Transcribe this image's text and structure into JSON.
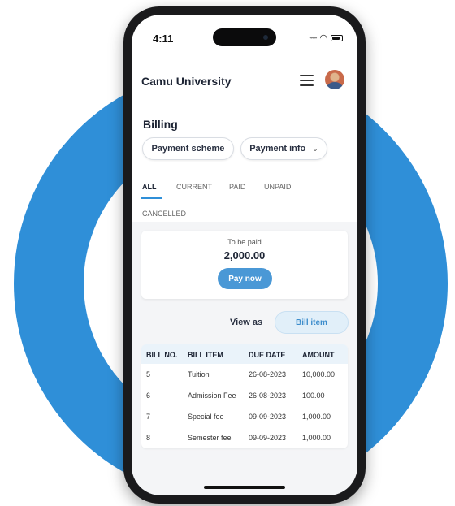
{
  "status_bar": {
    "time": "4:11"
  },
  "header": {
    "title": "Camu University"
  },
  "billing": {
    "title": "Billing",
    "buttons": {
      "payment_scheme": "Payment scheme",
      "payment_info": "Payment info"
    },
    "tabs": [
      {
        "label": "ALL",
        "active": true
      },
      {
        "label": "CURRENT",
        "active": false
      },
      {
        "label": "PAID",
        "active": false
      },
      {
        "label": "UNPAID",
        "active": false
      },
      {
        "label": "CANCELLED",
        "active": false
      }
    ]
  },
  "to_be_paid": {
    "label": "To be paid",
    "amount": "2,000.00",
    "pay_button": "Pay now"
  },
  "view_as": {
    "label": "View as",
    "selected": "Bill item"
  },
  "table": {
    "headers": [
      "BILL NO.",
      "BILL ITEM",
      "DUE DATE",
      "AMOUNT"
    ],
    "rows": [
      [
        "5",
        "Tuition",
        "26-08-2023",
        "10,000.00"
      ],
      [
        "6",
        "Admission Fee",
        "26-08-2023",
        "100.00"
      ],
      [
        "7",
        "Special fee",
        "09-09-2023",
        "1,000.00"
      ],
      [
        "8",
        "Semester fee",
        "09-09-2023",
        "1,000.00"
      ]
    ]
  },
  "colors": {
    "accent": "#2f8fd8",
    "pay_button": "#4a98d6",
    "bill_item_pill": "#e1eff9"
  },
  "icons": {
    "menu": "hamburger-icon",
    "dropdown": "chevron-down-icon",
    "wifi": "wifi-icon",
    "battery": "battery-icon"
  }
}
